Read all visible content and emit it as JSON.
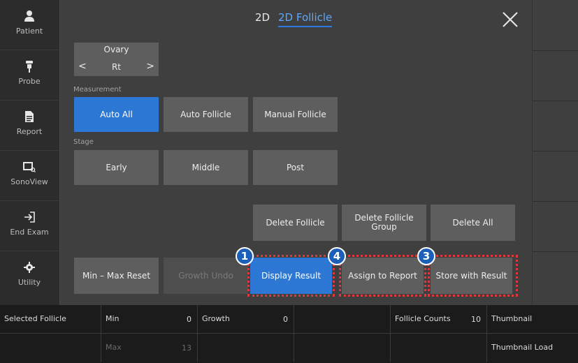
{
  "sidebar": {
    "items": [
      {
        "label": "Patient",
        "icon": "person-icon"
      },
      {
        "label": "Probe",
        "icon": "probe-icon"
      },
      {
        "label": "Report",
        "icon": "report-icon"
      },
      {
        "label": "SonoView",
        "icon": "sonoview-icon"
      },
      {
        "label": "End Exam",
        "icon": "exit-icon"
      },
      {
        "label": "Utility",
        "icon": "gear-icon"
      }
    ]
  },
  "header": {
    "tabs": [
      {
        "label": "2D",
        "active": false
      },
      {
        "label": "2D Follicle",
        "active": true
      }
    ],
    "close_icon": "close-icon"
  },
  "ovary": {
    "title": "Ovary",
    "value": "Rt",
    "prev": "<",
    "next": ">"
  },
  "measurement": {
    "label": "Measurement",
    "buttons": [
      "Auto All",
      "Auto Follicle",
      "Manual Follicle"
    ],
    "selected": "Auto All"
  },
  "stage": {
    "label": "Stage",
    "buttons": [
      "Early",
      "Middle",
      "Post"
    ]
  },
  "delete": {
    "follicle": "Delete Follicle",
    "group": "Delete Follicle Group",
    "all": "Delete All"
  },
  "actions": {
    "min_max_reset": "Min – Max Reset",
    "growth_undo": "Growth Undo",
    "display_result": "Display Result",
    "assign_to_report": "Assign to Report",
    "store_with_result": "Store with Result"
  },
  "badges": {
    "display_result": "1",
    "assign_to_report": "4",
    "store_with_result": "3"
  },
  "colors": {
    "accent": "#2c78d4",
    "tab_active": "#5aa8ff",
    "highlight": "#e0383c",
    "badge": "#1b5fb8"
  },
  "bottom": {
    "selected_follicle": "Selected Follicle",
    "min_label": "Min",
    "min_value": "0",
    "max_label": "Max",
    "max_value": "13",
    "growth_label": "Growth",
    "growth_value": "0",
    "follicle_counts_label": "Follicle Counts",
    "follicle_counts_value": "10",
    "thumbnail": "Thumbnail",
    "thumbnail_load": "Thumbnail Load"
  }
}
